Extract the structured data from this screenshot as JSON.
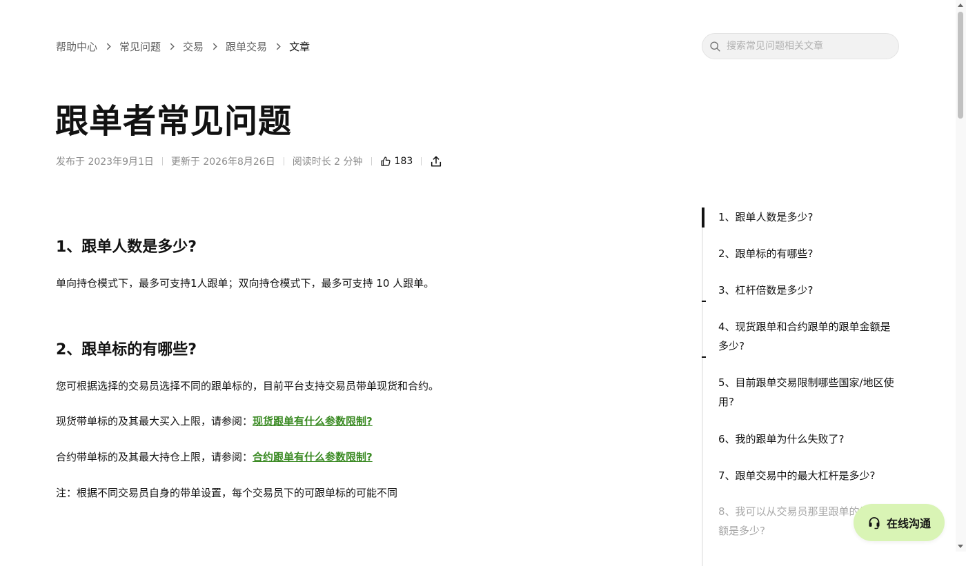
{
  "breadcrumb": {
    "items": [
      "帮助中心",
      "常见问题",
      "交易",
      "跟单交易"
    ],
    "current": "文章"
  },
  "search": {
    "placeholder": "搜索常见问题相关文章",
    "icon": "search-icon"
  },
  "article": {
    "title": "跟单者常见问题",
    "published": "发布于 2023年9月1日",
    "updated": "更新于 2026年8月26日",
    "read_time": "阅读时长 2 分钟",
    "likes": "183"
  },
  "content": {
    "s1": {
      "heading": "1、跟单人数是多少?",
      "p1": "单向持仓模式下，最多可支持1人跟单；双向持仓模式下，最多可支持 10 人跟单。"
    },
    "s2": {
      "heading": "2、跟单标的有哪些?",
      "p1": "您可根据选择的交易员选择不同的跟单标的，目前平台支持交易员带单现货和合约。",
      "p2_prefix": "现货带单标的及其最大买入上限，请参阅：",
      "p2_link": "现货跟单有什么参数限制? ",
      "p3_prefix": "合约带单标的及其最大持仓上限，请参阅：",
      "p3_link": "合约跟单有什么参数限制? ",
      "p4": "注：根据不同交易员自身的带单设置，每个交易员下的可跟单标的可能不同"
    }
  },
  "toc": {
    "items": [
      "1、跟单人数是多少?",
      "2、跟单标的有哪些?",
      "3、杠杆倍数是多少?",
      "4、现货跟单和合约跟单的跟单金额是多少?",
      "5、目前跟单交易限制哪些国家/地区使用?",
      "6、我的跟单为什么失败了?",
      "7、跟单交易中的最大杠杆是多少?",
      "8、我可以从交易员那里跟单的最大金额是多少?"
    ]
  },
  "chat": {
    "label": "在线沟通"
  },
  "colors": {
    "link": "#3a8a23",
    "chat_bg": "#d9f4b5",
    "text": "#121212",
    "muted": "#8a8a8a"
  }
}
